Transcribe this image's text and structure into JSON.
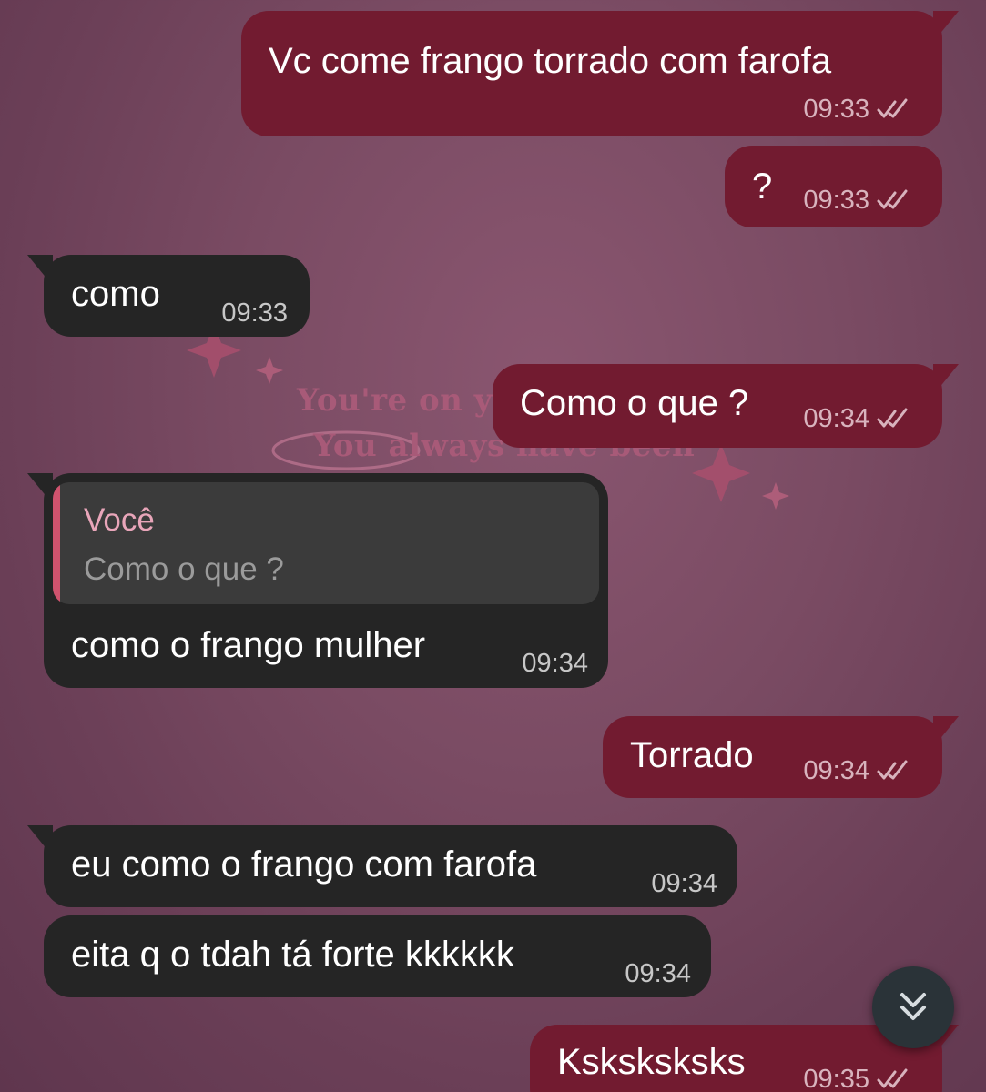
{
  "wallpaper": {
    "line1": "You're on yo",
    "line2": "You always have been"
  },
  "messages": [
    {
      "id": "m1",
      "direction": "out",
      "text": "Vc come frango torrado com farofa",
      "time": "09:33",
      "status": "read"
    },
    {
      "id": "m2",
      "direction": "out",
      "text": "?",
      "time": "09:33",
      "status": "read"
    },
    {
      "id": "m3",
      "direction": "in",
      "text": "como",
      "time": "09:33"
    },
    {
      "id": "m4",
      "direction": "out",
      "text": "Como o que ?",
      "time": "09:34",
      "status": "read"
    },
    {
      "id": "m5",
      "direction": "in",
      "text": "como o frango mulher",
      "time": "09:34",
      "reply": {
        "author": "Você",
        "text": "Como o que ?"
      }
    },
    {
      "id": "m6",
      "direction": "out",
      "text": "Torrado",
      "time": "09:34",
      "status": "read"
    },
    {
      "id": "m7",
      "direction": "in",
      "text": "eu como o frango com farofa",
      "time": "09:34"
    },
    {
      "id": "m8",
      "direction": "in",
      "text": "eita q o tdah tá forte kkkkkk",
      "time": "09:34"
    },
    {
      "id": "m9",
      "direction": "out",
      "text": "Ksksksksks",
      "time": "09:35",
      "status": "read"
    }
  ],
  "scroll_button": {
    "icon": "double-chevron-down-icon"
  },
  "colors": {
    "outgoing_bubble": "#721b30",
    "incoming_bubble": "#252525",
    "reply_accent": "#d0536e",
    "reply_author": "#e9a6ba",
    "background": "#7a4b63"
  }
}
